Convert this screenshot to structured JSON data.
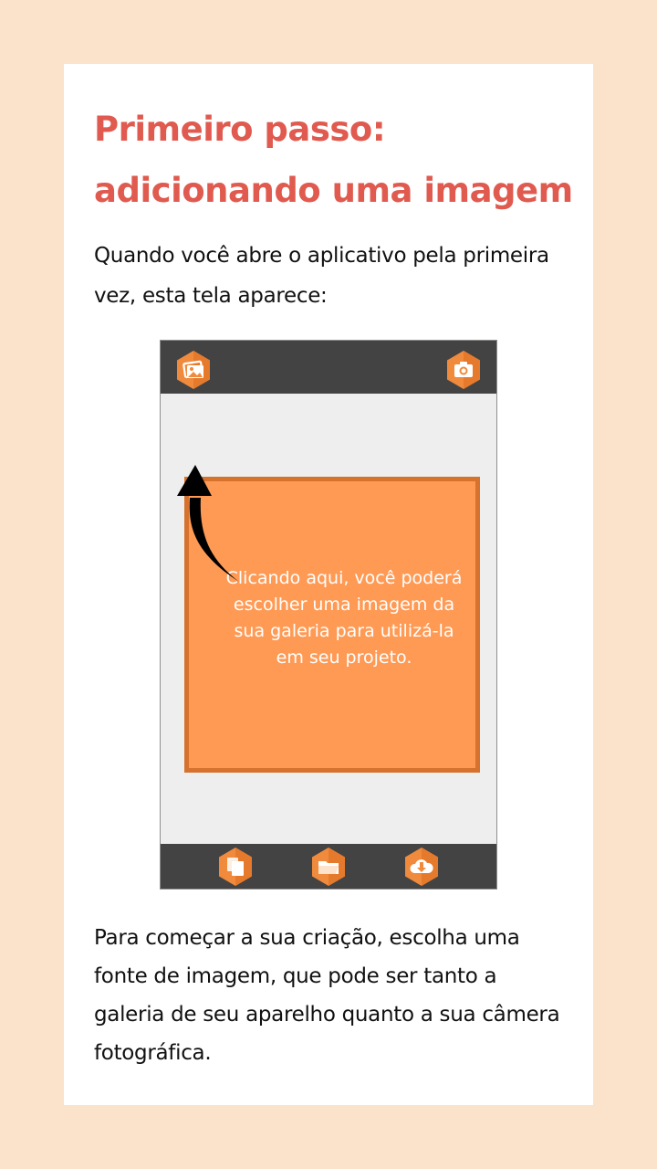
{
  "tutorial": {
    "title": "Primeiro passo: adicionando uma imagem",
    "intro": "Quando você abre o aplicativo pela primeira vez, esta tela aparece:",
    "outro": "Para começar a sua criação, escolha uma fonte de imagem, que pode ser tanto a galeria de seu aparelho quanto a sua câmera fotográfica."
  },
  "app_preview": {
    "top_bar": {
      "left_icon": "gallery-icon",
      "right_icon": "camera-icon"
    },
    "tooltip": {
      "text": "Clicando aqui, você poderá escolher uma imagem da sua galeria para utilizá-la em seu projeto."
    },
    "bottom_bar": {
      "icons": [
        "copy-pages-icon",
        "folder-icon",
        "cloud-download-icon"
      ]
    }
  },
  "colors": {
    "page_background": "#fbe3cb",
    "title": "#e05a4f",
    "app_bar": "#434343",
    "accent_orange": "#ff9a55",
    "accent_orange_dark": "#d6722d"
  }
}
